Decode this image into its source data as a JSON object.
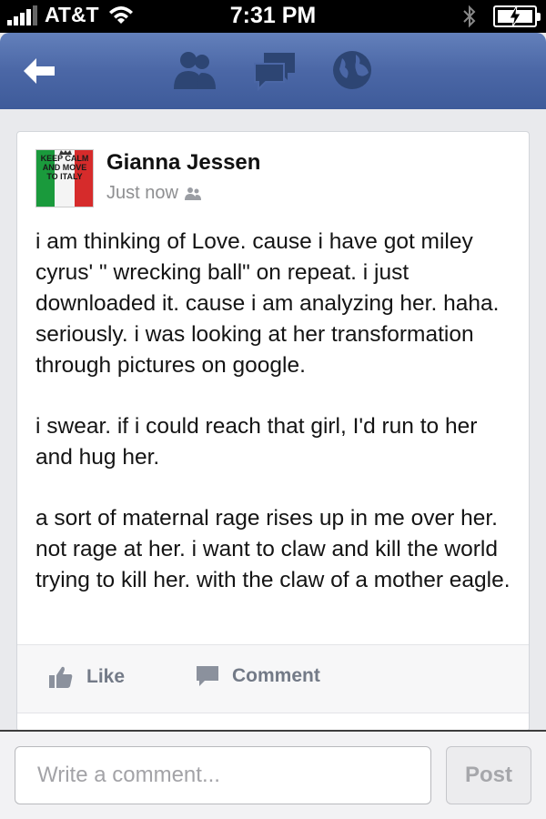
{
  "status_bar": {
    "carrier": "AT&T",
    "time": "7:31 PM",
    "signal_bars": 4,
    "battery_charging": true
  },
  "nav": {
    "back_icon": "back-arrow-icon",
    "icons": [
      "friend-requests-icon",
      "messages-icon",
      "notifications-globe-icon"
    ],
    "color": "#4b67a6"
  },
  "post": {
    "author": "Gianna Jessen",
    "timestamp": "Just now",
    "avatar_text": "KEEP CALM AND MOVE TO ITALY",
    "paragraphs": [
      "i am thinking of Love. cause i have got miley cyrus' \" wrecking ball\" on repeat. i just downloaded it. cause i am analyzing her. haha. seriously. i was looking at her transformation through pictures on google.",
      "i swear. if i could reach that girl, I'd run to her and hug her.",
      "a sort of maternal rage rises up in me over her. not rage at her. i want to claw and kill the world trying to kill her. with the claw of a mother eagle."
    ]
  },
  "actions": {
    "like_label": "Like",
    "comment_label": "Comment"
  },
  "composer": {
    "placeholder": "Write a comment...",
    "value": "",
    "post_label": "Post"
  }
}
